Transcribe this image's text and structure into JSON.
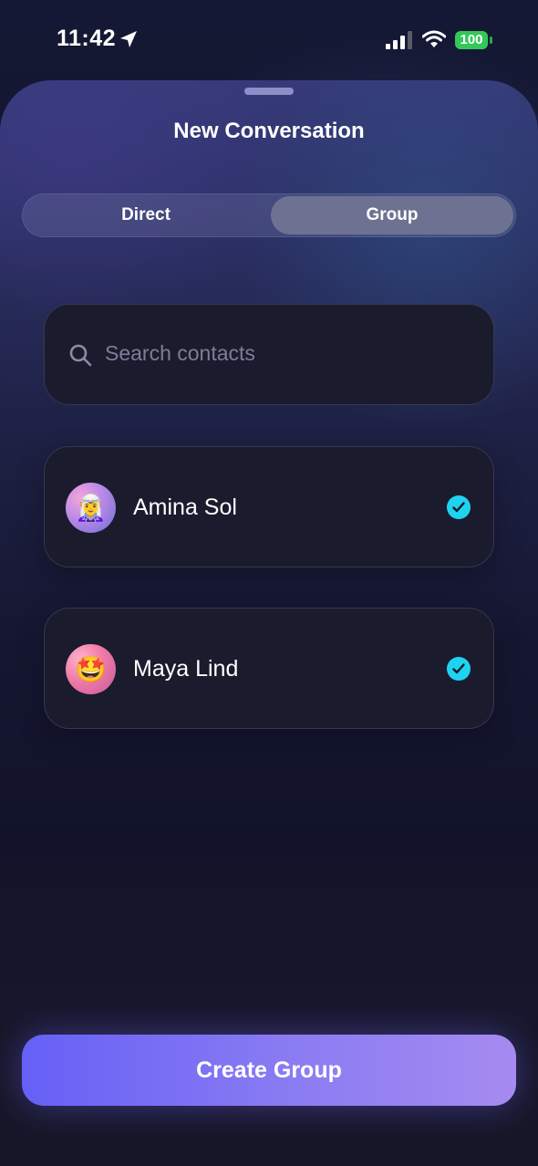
{
  "status_bar": {
    "time": "11:42",
    "battery": "100",
    "icons": [
      "location-arrow-icon",
      "signal-icon",
      "wifi-icon",
      "battery-icon"
    ]
  },
  "sheet": {
    "title": "New Conversation",
    "tabs": [
      {
        "label": "Direct",
        "selected": false
      },
      {
        "label": "Group",
        "selected": true
      }
    ]
  },
  "search": {
    "placeholder": "Search contacts",
    "icon": "search-icon"
  },
  "contacts": [
    {
      "name": "Amina Sol",
      "avatar_emoji": "🧝‍♀️",
      "selected": true
    },
    {
      "name": "Maya Lind",
      "avatar_emoji": "🤩",
      "selected": true
    }
  ],
  "actions": {
    "create_label": "Create Group"
  },
  "colors": {
    "accent_check": "#1fd3f0",
    "button_start": "#6660f6",
    "button_end": "#a58bf0",
    "battery": "#34c759"
  }
}
